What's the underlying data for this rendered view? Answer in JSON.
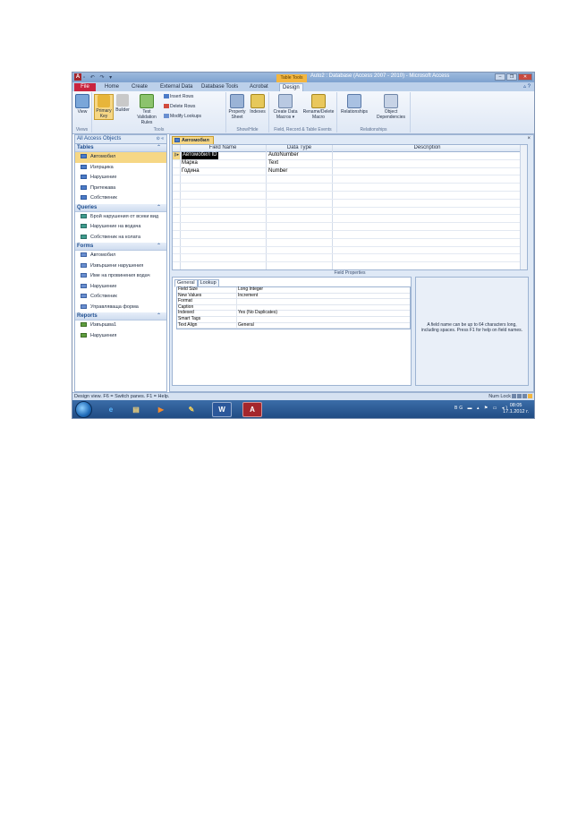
{
  "window": {
    "app_icon": "A",
    "qat": "▫ ↶ ↷ ▾",
    "context_tab": "Table Tools",
    "title": "Auto2 : Database (Access 2007 - 2010) - Microsoft Access",
    "controls": [
      "–",
      "❐",
      "✕"
    ]
  },
  "tabs": {
    "file": "File",
    "home": "Home",
    "create": "Create",
    "external": "External Data",
    "dbtools": "Database Tools",
    "acrobat": "Acrobat",
    "design": "Design",
    "help": "▵ ?"
  },
  "ribbon": {
    "view": "View",
    "views_group": "Views",
    "primary_key": "Primary Key",
    "builder": "Builder",
    "test_validation": "Test Validation Rules",
    "insert_rows": "Insert Rows",
    "delete_rows": "Delete Rows",
    "modify_lookups": "Modify Lookups",
    "tools_group": "Tools",
    "property_sheet": "Property Sheet",
    "indexes": "Indexes",
    "showhide_group": "Show/Hide",
    "create_data_macros": "Create Data Macros ▾",
    "rename_delete_macro": "Rename/Delete Macro",
    "events_group": "Field, Record & Table Events",
    "relationships": "Relationships",
    "object_dependencies": "Object Dependencies",
    "relationships_group": "Relationships"
  },
  "nav": {
    "title": "All Access Objects",
    "title_ctl": "⊙ «",
    "sections": [
      {
        "name": "Tables",
        "items": [
          "Автомобил",
          "Изпрщика",
          "Нарушение",
          "Притежава",
          "Собственик"
        ]
      },
      {
        "name": "Queries",
        "items": [
          "Брой нарушения от всеки вид",
          "Нарушение на водача",
          "Собственик на колата"
        ]
      },
      {
        "name": "Forms",
        "items": [
          "Автомобил",
          "Извършени нарушения",
          "Име на провинения водач",
          "Нарушение",
          "Собственик",
          "Управляваща форма"
        ]
      },
      {
        "name": "Reports",
        "items": [
          "Извършва1",
          "Нарушения"
        ]
      }
    ]
  },
  "document": {
    "tab_label": "Автомобил",
    "close": "×",
    "columns": [
      "Field Name",
      "Data Type",
      "Description"
    ],
    "rows": [
      {
        "field": "Автомобил ID",
        "type": "AutoNumber",
        "desc": ""
      },
      {
        "field": "Марка",
        "type": "Text",
        "desc": ""
      },
      {
        "field": "Година",
        "type": "Number",
        "desc": ""
      }
    ],
    "field_properties_label": "Field Properties",
    "prop_tabs": [
      "General",
      "Lookup"
    ],
    "properties": [
      {
        "k": "Field Size",
        "v": "Long Integer"
      },
      {
        "k": "New Values",
        "v": "Increment"
      },
      {
        "k": "Format",
        "v": ""
      },
      {
        "k": "Caption",
        "v": ""
      },
      {
        "k": "Indexed",
        "v": "Yes (No Duplicates)"
      },
      {
        "k": "Smart Tags",
        "v": ""
      },
      {
        "k": "Text Align",
        "v": "General"
      }
    ],
    "help_text": "A field name can be up to 64 characters long, including spaces. Press F1 for help on field names."
  },
  "status": {
    "left": "Design view.  F6 = Switch panes.  F1 = Help.",
    "right": "Num Lock"
  },
  "taskbar": {
    "apps": [
      "e",
      "▤",
      "▶",
      "✎",
      "W",
      "A"
    ],
    "tray": "BG ▬ ▴ ⚑ ▭ ◂)",
    "time": "08:05",
    "date": "17.1.2012 г."
  },
  "colors": {
    "accent_file": "#c9243f",
    "selection": "#f6d785",
    "taskbar": "#1f4a82"
  }
}
